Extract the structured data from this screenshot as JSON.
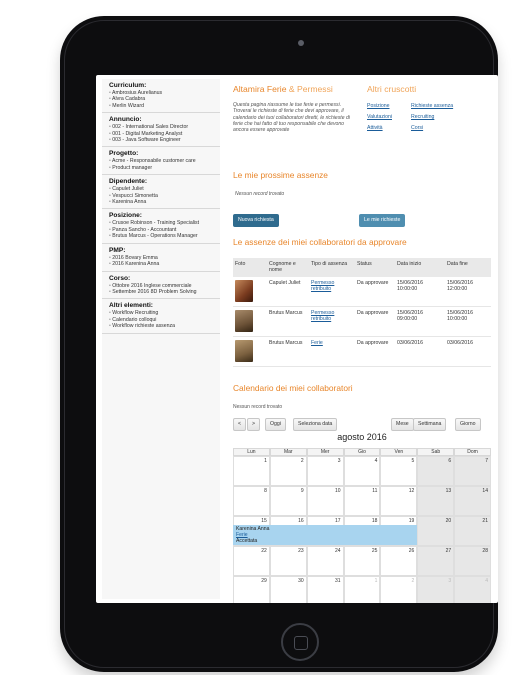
{
  "sidebar": [
    {
      "title": "Curriculum:",
      "items": [
        "Ambrosius Aurelianus",
        "Alvra Cadabra",
        "Merlin Wizard"
      ]
    },
    {
      "title": "Annuncio:",
      "items": [
        "002 - International Sales Director",
        "001 - Digital Marketing Analyst",
        "003 - Java Software Engineer"
      ]
    },
    {
      "title": "Progetto:",
      "items": [
        "Acme - Responsabile customer care",
        "Product manager"
      ]
    },
    {
      "title": "Dipendente:",
      "items": [
        "Capulet Juliet",
        "Vespucci Simonetta",
        "Karenina Anna"
      ]
    },
    {
      "title": "Posizione:",
      "items": [
        "Crusoe Robinson - Training Specialist",
        "Panza Sancho - Accountant",
        "Brutus Marcus - Operations Manager"
      ]
    },
    {
      "title": "PMP:",
      "items": [
        "2016 Bovary Emma",
        "2016 Karenina Anna"
      ]
    },
    {
      "title": "Corso:",
      "items": [
        "Ottobre 2016 Inglese commerciale",
        "Settembre 2016 8D Problem Solving"
      ]
    },
    {
      "title": "Altri elementi:",
      "items": [
        "Workflow Recruiting",
        "Calendario colloqui",
        "Workflow richieste assenza"
      ]
    }
  ],
  "main": {
    "title_a": "Altamira Ferie",
    "title_b": "& Permessi",
    "right_title": "Altri cruscotti",
    "intro": "Questa pagina riassume le tue ferie e permessi. Troverai le richieste di ferie che devi approvare, il calendario dei tuoi collaboratori diretti, le richieste di ferie che hai fatto di tuo responsabile che devono ancora essere approvate",
    "links": [
      "Posizione",
      "Richieste assenza",
      "Valutazioni",
      "Recruiting",
      "Attività",
      "Corsi"
    ],
    "next_title": "Le mie prossime assenze",
    "no_records": "Nessun record trovato",
    "btn_new": "Nuova richiesta",
    "btn_mine": "Le mie richieste",
    "approve_title": "Le assenze dei miei collaboratori da approvare",
    "table_headers": [
      "Foto",
      "Cognome e nome",
      "Tipo di assenza",
      "Status",
      "Data inizio",
      "Data fine"
    ],
    "rows": [
      {
        "name": "Capulet Juliet",
        "type": "Permesso retribuito",
        "status": "Da approvare",
        "start": "15/06/2016 10:00:00",
        "end": "15/06/2016 12:00:00"
      },
      {
        "name": "Brutus Marcus",
        "type": "Permesso retribuito",
        "status": "Da approvare",
        "start": "15/06/2016 09:00:00",
        "end": "15/06/2016 10:00:00"
      },
      {
        "name": "Brutus Marcus",
        "type": "Ferie",
        "status": "Da approvare",
        "start": "03/06/2016",
        "end": "03/06/2016"
      }
    ],
    "calendar_title": "Calendario dei miei collaboratori",
    "cal_no_records": "Nessun record trovato",
    "cal_buttons": {
      "prev": "<",
      "next": ">",
      "today": "Oggi",
      "select": "Seleziona data",
      "month": "Mese",
      "week": "Settimana",
      "day": "Giorno"
    },
    "month_label": "agosto 2016",
    "weekdays": [
      "Lun",
      "Mar",
      "Mer",
      "Gio",
      "Ven",
      "Sab",
      "Dom"
    ],
    "weeks": [
      [
        "1",
        "2",
        "3",
        "4",
        "5",
        "6",
        "7"
      ],
      [
        "8",
        "9",
        "10",
        "11",
        "12",
        "13",
        "14"
      ],
      [
        "15",
        "16",
        "17",
        "18",
        "19",
        "20",
        "21"
      ],
      [
        "22",
        "23",
        "24",
        "25",
        "26",
        "27",
        "28"
      ],
      [
        "29",
        "30",
        "31",
        "1",
        "2",
        "3",
        "4"
      ]
    ],
    "event": {
      "name": "Karenina Anna",
      "type": "Ferie",
      "status": "Accettata"
    }
  }
}
